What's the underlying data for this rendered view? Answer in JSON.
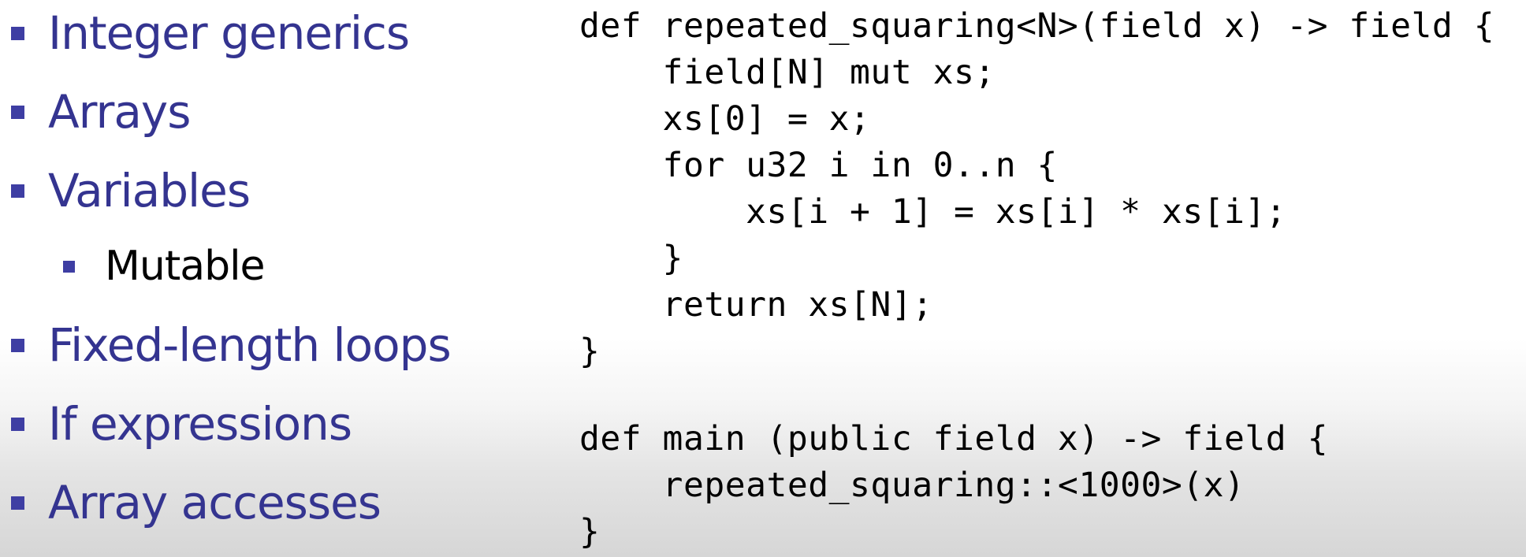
{
  "bullets": [
    {
      "text": "Integer generics",
      "level": 1
    },
    {
      "text": "Arrays",
      "level": 1
    },
    {
      "text": "Variables",
      "level": 1
    },
    {
      "text": "Mutable",
      "level": 2
    },
    {
      "text": "Fixed-length loops",
      "level": 1
    },
    {
      "text": "If expressions",
      "level": 1
    },
    {
      "text": "Array accesses",
      "level": 1
    }
  ],
  "code": [
    "def repeated_squaring<N>(field x) -> field {",
    "    field[N] mut xs;",
    "    xs[0] = x;",
    "    for u32 i in 0..n {",
    "        xs[i + 1] = xs[i] * xs[i];",
    "    }",
    "    return xs[N];",
    "}",
    "def main (public field x) -> field {",
    "    repeated_squaring::<1000>(x)",
    "}"
  ],
  "colors": {
    "bullet_text": "#343490",
    "bullet_marker": "#3e3ea3",
    "sub_bullet_text": "#000000",
    "code_text": "#000000"
  }
}
